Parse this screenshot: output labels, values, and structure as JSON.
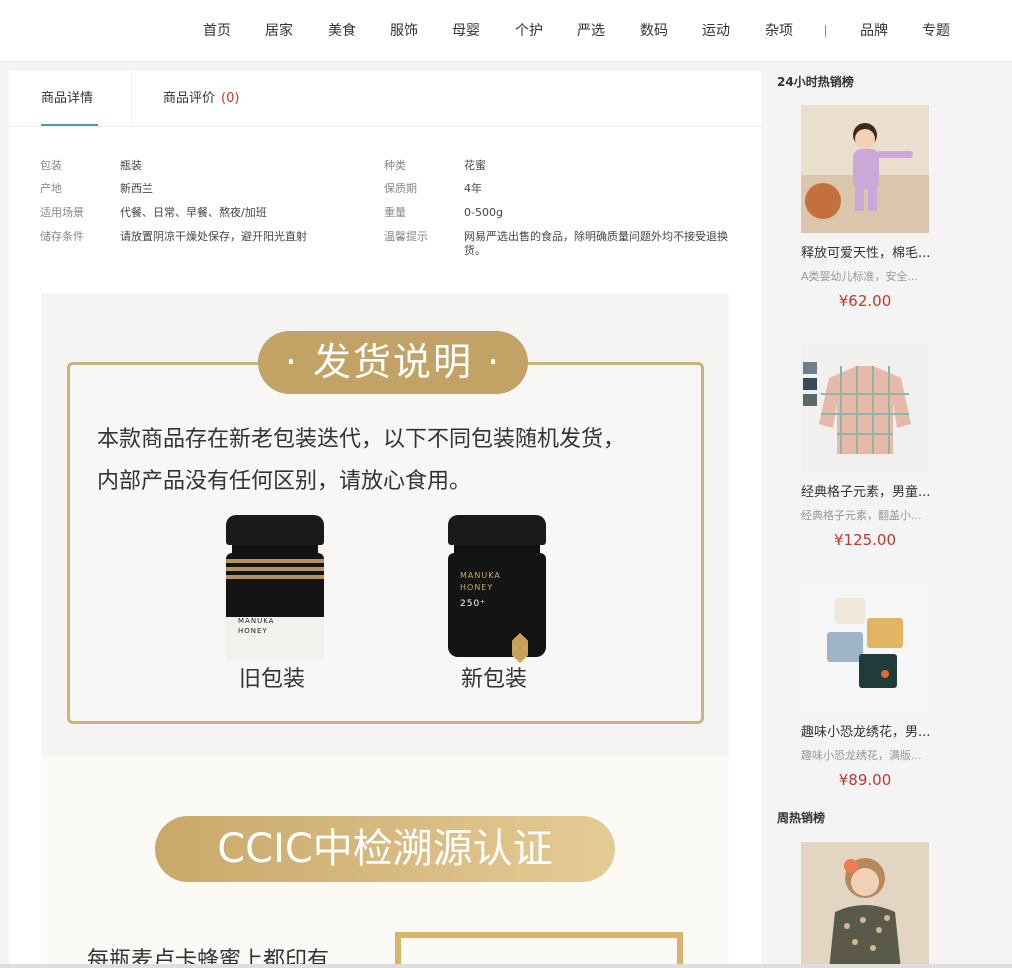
{
  "nav": {
    "items": [
      "首页",
      "居家",
      "美食",
      "服饰",
      "母婴",
      "个护",
      "严选",
      "数码",
      "运动",
      "杂项",
      "品牌",
      "专题"
    ]
  },
  "tabs": {
    "details": "商品详情",
    "reviews": "商品评价",
    "review_count": "(0)"
  },
  "attributes": [
    {
      "key": "包装",
      "value": "瓶装"
    },
    {
      "key": "种类",
      "value": "花蜜"
    },
    {
      "key": "产地",
      "value": "新西兰"
    },
    {
      "key": "保质期",
      "value": "4年"
    },
    {
      "key": "适用场景",
      "value": "代餐、日常、早餐、熬夜/加班"
    },
    {
      "key": "重量",
      "value": "0-500g"
    },
    {
      "key": "储存条件",
      "value": "请放置阴凉干燥处保存，避开阳光直射"
    },
    {
      "key": "温馨提示",
      "value": "网易严选出售的食品，除明确质量问题外均不接受退换货。"
    }
  ],
  "banner1": {
    "title": "· 发货说明 ·",
    "line1": "本款商品存在新老包装迭代，以下不同包装随机发货，",
    "line2": "内部产品没有任何区别，请放心食用。",
    "old_label": "旧包装",
    "new_label": "新包装",
    "old_jar_text1": "MANUKA",
    "old_jar_text2": "HONEY",
    "new_jar_text1": "MANUKA",
    "new_jar_text2": "HONEY",
    "new_jar_text3": "250⁺"
  },
  "banner2": {
    "title": "CCIC中检溯源认证",
    "text": "每瓶麦卢卡蜂蜜上都印有"
  },
  "sidebar": {
    "hot24_title": "24小时热销榜",
    "weekly_title": "周热销榜",
    "products": [
      {
        "name": "释放可爱天性，棉毛...",
        "sub": "A类婴幼儿标准，安全...",
        "price": "¥62.00"
      },
      {
        "name": "经典格子元素，男童...",
        "sub": "经典格子元素，翻盖小...",
        "price": "¥125.00"
      },
      {
        "name": "趣味小恐龙绣花，男...",
        "sub": "趣味小恐龙绣花，满版...",
        "price": "¥89.00"
      }
    ]
  },
  "colors": {
    "accent": "#3aa69a",
    "price": "#c0392b",
    "gold": "#c2a265"
  }
}
